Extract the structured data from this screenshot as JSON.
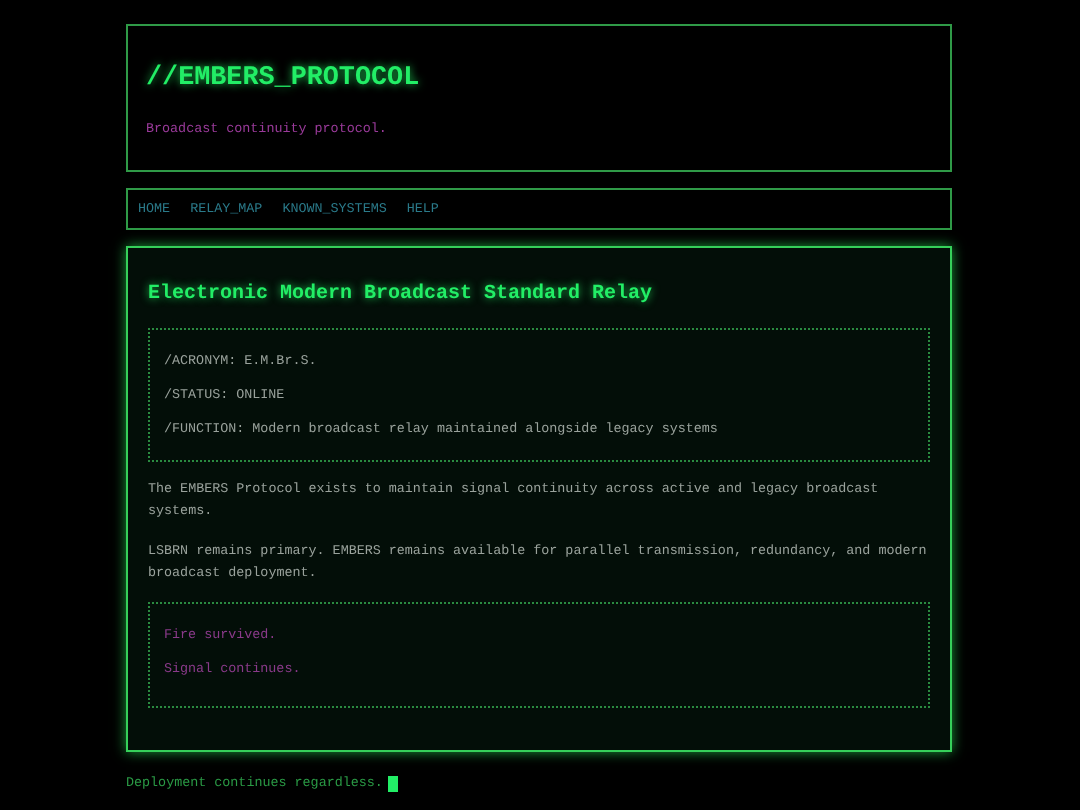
{
  "header": {
    "title": "//EMBERS_PROTOCOL",
    "subtitle": "Broadcast continuity protocol."
  },
  "nav": [
    "HOME",
    "RELAY_MAP",
    "KNOWN_SYSTEMS",
    "HELP"
  ],
  "main": {
    "title": "Electronic Modern Broadcast Standard Relay",
    "specs": [
      "/ACRONYM: E.M.Br.S.",
      "/STATUS: ONLINE",
      "/FUNCTION: Modern broadcast relay maintained alongside legacy systems"
    ],
    "paragraphs": [
      "The EMBERS Protocol exists to maintain signal continuity across active and legacy broadcast systems.",
      "LSBRN remains primary. EMBERS remains available for parallel transmission, redundancy, and modern broadcast deployment."
    ],
    "notes": [
      "Fire survived.",
      "Signal continues."
    ]
  },
  "footer": "Deployment continues regardless."
}
